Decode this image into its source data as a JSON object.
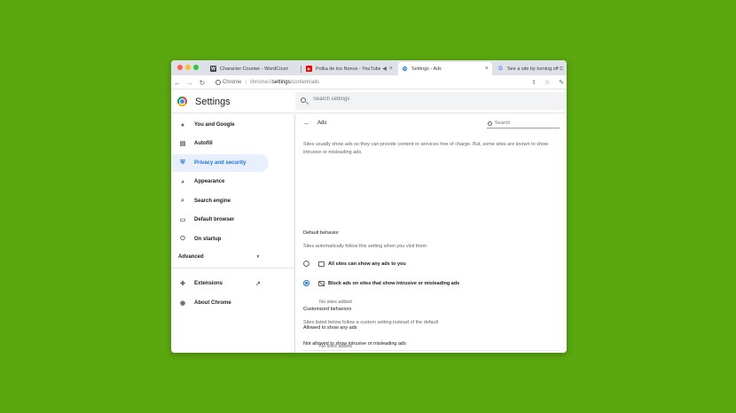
{
  "tabs": [
    {
      "label": "Character Counter - WordCounter",
      "favicon": "W"
    },
    {
      "label": "Polka de los Ñonos - YouTube",
      "favicon": "▶"
    },
    {
      "label": "Settings - Ads",
      "favicon": "⚙"
    },
    {
      "label": "See a site by turning off Chrome",
      "favicon": "G"
    }
  ],
  "toolbar": {
    "chip": "Chrome",
    "url_scheme": "chrome://",
    "url_host": "settings",
    "url_path": "/content/ads"
  },
  "header": {
    "title": "Settings",
    "search_placeholder": "Search settings"
  },
  "sidebar": {
    "items": [
      {
        "label": "You and Google",
        "icon": "person-icon"
      },
      {
        "label": "Autofill",
        "icon": "clipboard-icon"
      },
      {
        "label": "Privacy and security",
        "icon": "shield-icon"
      },
      {
        "label": "Appearance",
        "icon": "palette-icon"
      },
      {
        "label": "Search engine",
        "icon": "search-icon"
      },
      {
        "label": "Default browser",
        "icon": "browser-icon"
      },
      {
        "label": "On startup",
        "icon": "power-icon"
      }
    ],
    "advanced": "Advanced",
    "extensions": "Extensions",
    "about": "About Chrome"
  },
  "main": {
    "title": "Ads",
    "search_placeholder": "Search",
    "description": "Sites usually show ads so they can provide content or services free of charge. But, some sites are known to show intrusive or misleading ads.",
    "default_behavior_title": "Default behavior",
    "default_behavior_sub": "Sites automatically follow this setting when you visit them",
    "option_all": "All sites can show any ads to you",
    "option_block": "Block ads on sites that show intrusive or misleading ads",
    "selected_option": "option_block",
    "customized_title": "Customized behaviors",
    "customized_sub": "Sites listed below follow a custom setting instead of the default",
    "not_allowed_title": "Not allowed to show intrusive or misleading ads",
    "not_allowed_empty": "No sites added",
    "allowed_title": "Allowed to show any ads",
    "allowed_empty": "No sites added"
  },
  "colors": {
    "background": "#5aa70f",
    "accent": "#1a73e8",
    "active_nav_bg": "#e8f0fe"
  }
}
